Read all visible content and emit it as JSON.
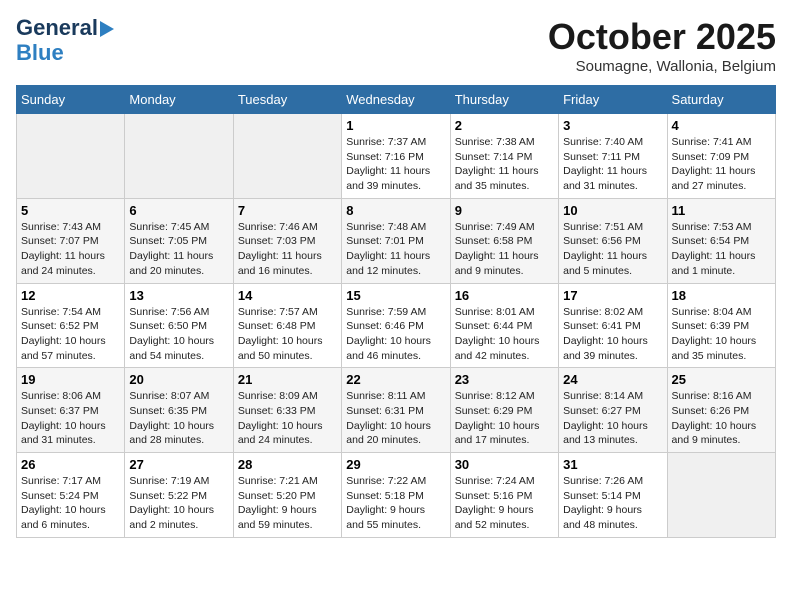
{
  "logo": {
    "line1": "General",
    "line2": "Blue"
  },
  "title": "October 2025",
  "subtitle": "Soumagne, Wallonia, Belgium",
  "headers": [
    "Sunday",
    "Monday",
    "Tuesday",
    "Wednesday",
    "Thursday",
    "Friday",
    "Saturday"
  ],
  "weeks": [
    [
      {
        "day": "",
        "info": ""
      },
      {
        "day": "",
        "info": ""
      },
      {
        "day": "",
        "info": ""
      },
      {
        "day": "1",
        "info": "Sunrise: 7:37 AM\nSunset: 7:16 PM\nDaylight: 11 hours\nand 39 minutes."
      },
      {
        "day": "2",
        "info": "Sunrise: 7:38 AM\nSunset: 7:14 PM\nDaylight: 11 hours\nand 35 minutes."
      },
      {
        "day": "3",
        "info": "Sunrise: 7:40 AM\nSunset: 7:11 PM\nDaylight: 11 hours\nand 31 minutes."
      },
      {
        "day": "4",
        "info": "Sunrise: 7:41 AM\nSunset: 7:09 PM\nDaylight: 11 hours\nand 27 minutes."
      }
    ],
    [
      {
        "day": "5",
        "info": "Sunrise: 7:43 AM\nSunset: 7:07 PM\nDaylight: 11 hours\nand 24 minutes."
      },
      {
        "day": "6",
        "info": "Sunrise: 7:45 AM\nSunset: 7:05 PM\nDaylight: 11 hours\nand 20 minutes."
      },
      {
        "day": "7",
        "info": "Sunrise: 7:46 AM\nSunset: 7:03 PM\nDaylight: 11 hours\nand 16 minutes."
      },
      {
        "day": "8",
        "info": "Sunrise: 7:48 AM\nSunset: 7:01 PM\nDaylight: 11 hours\nand 12 minutes."
      },
      {
        "day": "9",
        "info": "Sunrise: 7:49 AM\nSunset: 6:58 PM\nDaylight: 11 hours\nand 9 minutes."
      },
      {
        "day": "10",
        "info": "Sunrise: 7:51 AM\nSunset: 6:56 PM\nDaylight: 11 hours\nand 5 minutes."
      },
      {
        "day": "11",
        "info": "Sunrise: 7:53 AM\nSunset: 6:54 PM\nDaylight: 11 hours\nand 1 minute."
      }
    ],
    [
      {
        "day": "12",
        "info": "Sunrise: 7:54 AM\nSunset: 6:52 PM\nDaylight: 10 hours\nand 57 minutes."
      },
      {
        "day": "13",
        "info": "Sunrise: 7:56 AM\nSunset: 6:50 PM\nDaylight: 10 hours\nand 54 minutes."
      },
      {
        "day": "14",
        "info": "Sunrise: 7:57 AM\nSunset: 6:48 PM\nDaylight: 10 hours\nand 50 minutes."
      },
      {
        "day": "15",
        "info": "Sunrise: 7:59 AM\nSunset: 6:46 PM\nDaylight: 10 hours\nand 46 minutes."
      },
      {
        "day": "16",
        "info": "Sunrise: 8:01 AM\nSunset: 6:44 PM\nDaylight: 10 hours\nand 42 minutes."
      },
      {
        "day": "17",
        "info": "Sunrise: 8:02 AM\nSunset: 6:41 PM\nDaylight: 10 hours\nand 39 minutes."
      },
      {
        "day": "18",
        "info": "Sunrise: 8:04 AM\nSunset: 6:39 PM\nDaylight: 10 hours\nand 35 minutes."
      }
    ],
    [
      {
        "day": "19",
        "info": "Sunrise: 8:06 AM\nSunset: 6:37 PM\nDaylight: 10 hours\nand 31 minutes."
      },
      {
        "day": "20",
        "info": "Sunrise: 8:07 AM\nSunset: 6:35 PM\nDaylight: 10 hours\nand 28 minutes."
      },
      {
        "day": "21",
        "info": "Sunrise: 8:09 AM\nSunset: 6:33 PM\nDaylight: 10 hours\nand 24 minutes."
      },
      {
        "day": "22",
        "info": "Sunrise: 8:11 AM\nSunset: 6:31 PM\nDaylight: 10 hours\nand 20 minutes."
      },
      {
        "day": "23",
        "info": "Sunrise: 8:12 AM\nSunset: 6:29 PM\nDaylight: 10 hours\nand 17 minutes."
      },
      {
        "day": "24",
        "info": "Sunrise: 8:14 AM\nSunset: 6:27 PM\nDaylight: 10 hours\nand 13 minutes."
      },
      {
        "day": "25",
        "info": "Sunrise: 8:16 AM\nSunset: 6:26 PM\nDaylight: 10 hours\nand 9 minutes."
      }
    ],
    [
      {
        "day": "26",
        "info": "Sunrise: 7:17 AM\nSunset: 5:24 PM\nDaylight: 10 hours\nand 6 minutes."
      },
      {
        "day": "27",
        "info": "Sunrise: 7:19 AM\nSunset: 5:22 PM\nDaylight: 10 hours\nand 2 minutes."
      },
      {
        "day": "28",
        "info": "Sunrise: 7:21 AM\nSunset: 5:20 PM\nDaylight: 9 hours\nand 59 minutes."
      },
      {
        "day": "29",
        "info": "Sunrise: 7:22 AM\nSunset: 5:18 PM\nDaylight: 9 hours\nand 55 minutes."
      },
      {
        "day": "30",
        "info": "Sunrise: 7:24 AM\nSunset: 5:16 PM\nDaylight: 9 hours\nand 52 minutes."
      },
      {
        "day": "31",
        "info": "Sunrise: 7:26 AM\nSunset: 5:14 PM\nDaylight: 9 hours\nand 48 minutes."
      },
      {
        "day": "",
        "info": ""
      }
    ]
  ]
}
